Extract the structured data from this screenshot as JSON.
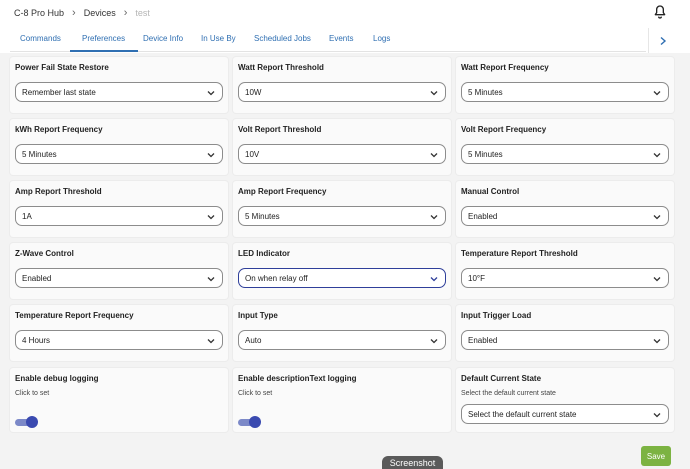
{
  "breadcrumb": [
    "C-8 Pro Hub",
    "Devices",
    "test"
  ],
  "tabs": [
    {
      "label": "Commands",
      "active": false
    },
    {
      "label": "Preferences",
      "active": true
    },
    {
      "label": "Device Info",
      "active": false
    },
    {
      "label": "In Use By",
      "active": false
    },
    {
      "label": "Scheduled Jobs",
      "active": false
    },
    {
      "label": "Events",
      "active": false
    },
    {
      "label": "Logs",
      "active": false
    }
  ],
  "prefs": {
    "power_fail": {
      "label": "Power Fail State Restore",
      "value": "Remember last state"
    },
    "watt_threshold": {
      "label": "Watt Report Threshold",
      "value": "10W"
    },
    "watt_frequency": {
      "label": "Watt Report Frequency",
      "value": "5 Minutes"
    },
    "kwh_frequency": {
      "label": "kWh Report Frequency",
      "value": "5 Minutes"
    },
    "volt_threshold": {
      "label": "Volt Report Threshold",
      "value": "10V"
    },
    "volt_frequency": {
      "label": "Volt Report Frequency",
      "value": "5 Minutes"
    },
    "amp_threshold": {
      "label": "Amp Report Threshold",
      "value": "1A"
    },
    "amp_frequency": {
      "label": "Amp Report Frequency",
      "value": "5 Minutes"
    },
    "manual_control": {
      "label": "Manual Control",
      "value": "Enabled"
    },
    "zwave_control": {
      "label": "Z-Wave Control",
      "value": "Enabled"
    },
    "led_indicator": {
      "label": "LED Indicator",
      "value": "On when relay off"
    },
    "temp_threshold": {
      "label": "Temperature Report Threshold",
      "value": "10°F"
    },
    "temp_frequency": {
      "label": "Temperature Report Frequency",
      "value": "4 Hours"
    },
    "input_type": {
      "label": "Input Type",
      "value": "Auto"
    },
    "input_trigger": {
      "label": "Input Trigger Load",
      "value": "Enabled"
    },
    "debug_logging": {
      "label": "Enable debug logging",
      "hint": "Click to set",
      "enabled": true
    },
    "desc_logging": {
      "label": "Enable descriptionText logging",
      "hint": "Click to set",
      "enabled": true
    },
    "default_state": {
      "label": "Default Current State",
      "hint": "Select the default current state",
      "value": "Select the default current state"
    }
  },
  "save_label": "Save",
  "screenshot_label": "Screenshot",
  "colors": {
    "accent": "#2f6fb2",
    "toggle": "#3a4ab0",
    "save": "#7cb342"
  },
  "icons": {
    "bell": "bell-icon",
    "next": "chevron-right-icon",
    "select": "chevron-down-icon"
  }
}
